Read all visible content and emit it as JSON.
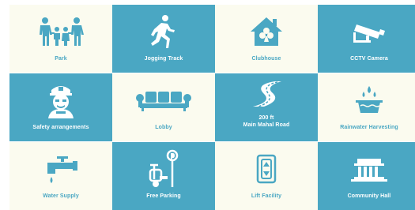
{
  "colors": {
    "teal": "#4aa7c3",
    "cream": "#fbfbef",
    "white": "#ffffff"
  },
  "amenities": [
    {
      "label": "Park",
      "icon": "family-icon"
    },
    {
      "label": "Jogging Track",
      "icon": "runner-icon"
    },
    {
      "label": "Clubhouse",
      "icon": "clubhouse-icon"
    },
    {
      "label": "CCTV Camera",
      "icon": "cctv-camera-icon"
    },
    {
      "label": "Safety arrangements",
      "icon": "security-guard-icon"
    },
    {
      "label": "Lobby",
      "icon": "sofa-icon"
    },
    {
      "label_line1": "200 ft",
      "label_line2": "Main Mahal Road",
      "icon": "road-icon"
    },
    {
      "label": "Rainwater Harvesting",
      "icon": "rainwater-icon"
    },
    {
      "label": "Water Supply",
      "icon": "water-tap-icon"
    },
    {
      "label": "Free Parking",
      "icon": "parking-scooter-icon"
    },
    {
      "label": "Lift Facility",
      "icon": "elevator-icon"
    },
    {
      "label": "Community Hall",
      "icon": "community-hall-icon"
    }
  ]
}
